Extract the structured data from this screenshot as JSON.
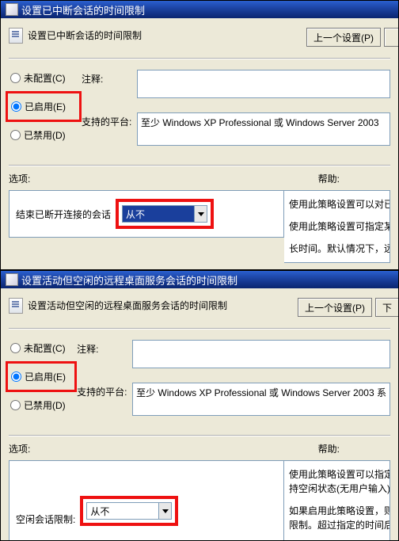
{
  "win1": {
    "title": "设置已中断会话的时间限制",
    "header": "设置已中断会话的时间限制",
    "prev_btn": "上一个设置(P)",
    "radios": {
      "unconfig": "未配置(C)",
      "enabled": "已启用(E)",
      "disabled": "已禁用(D)"
    },
    "comment_label": "注释:",
    "platform_label": "支持的平台:",
    "platform_text": "至少 Windows XP Professional 或 Windows Server 2003",
    "options_label": "选项:",
    "help_label": "帮助:",
    "opt_text": "结束已断开连接的会话",
    "combo_value": "从不",
    "help_p1": "使用此策略设置可以对已",
    "help_p2": "使用此策略设置可指定某",
    "help_p3": "长时间。默认情况下，远"
  },
  "win2": {
    "title": "设置活动但空闲的远程桌面服务会话的时间限制",
    "header": "设置活动但空闲的远程桌面服务会话的时间限制",
    "prev_btn": "上一个设置(P)",
    "next_btn_cut": "下",
    "radios": {
      "unconfig": "未配置(C)",
      "enabled": "已启用(E)",
      "disabled": "已禁用(D)"
    },
    "comment_label": "注释:",
    "platform_label": "支持的平台:",
    "platform_text": "至少 Windows XP Professional 或 Windows Server 2003 系",
    "options_label": "选项:",
    "help_label": "帮助:",
    "opt_text": "空闲会话限制:",
    "combo_value": "从不",
    "help_p1": "使用此策略设置可以指定活",
    "help_p2": "持空闲状态(无用户输入)的最",
    "help_p3": "如果启用此策略设置，则必",
    "help_p4": "限制。超过指定的时间后，"
  }
}
